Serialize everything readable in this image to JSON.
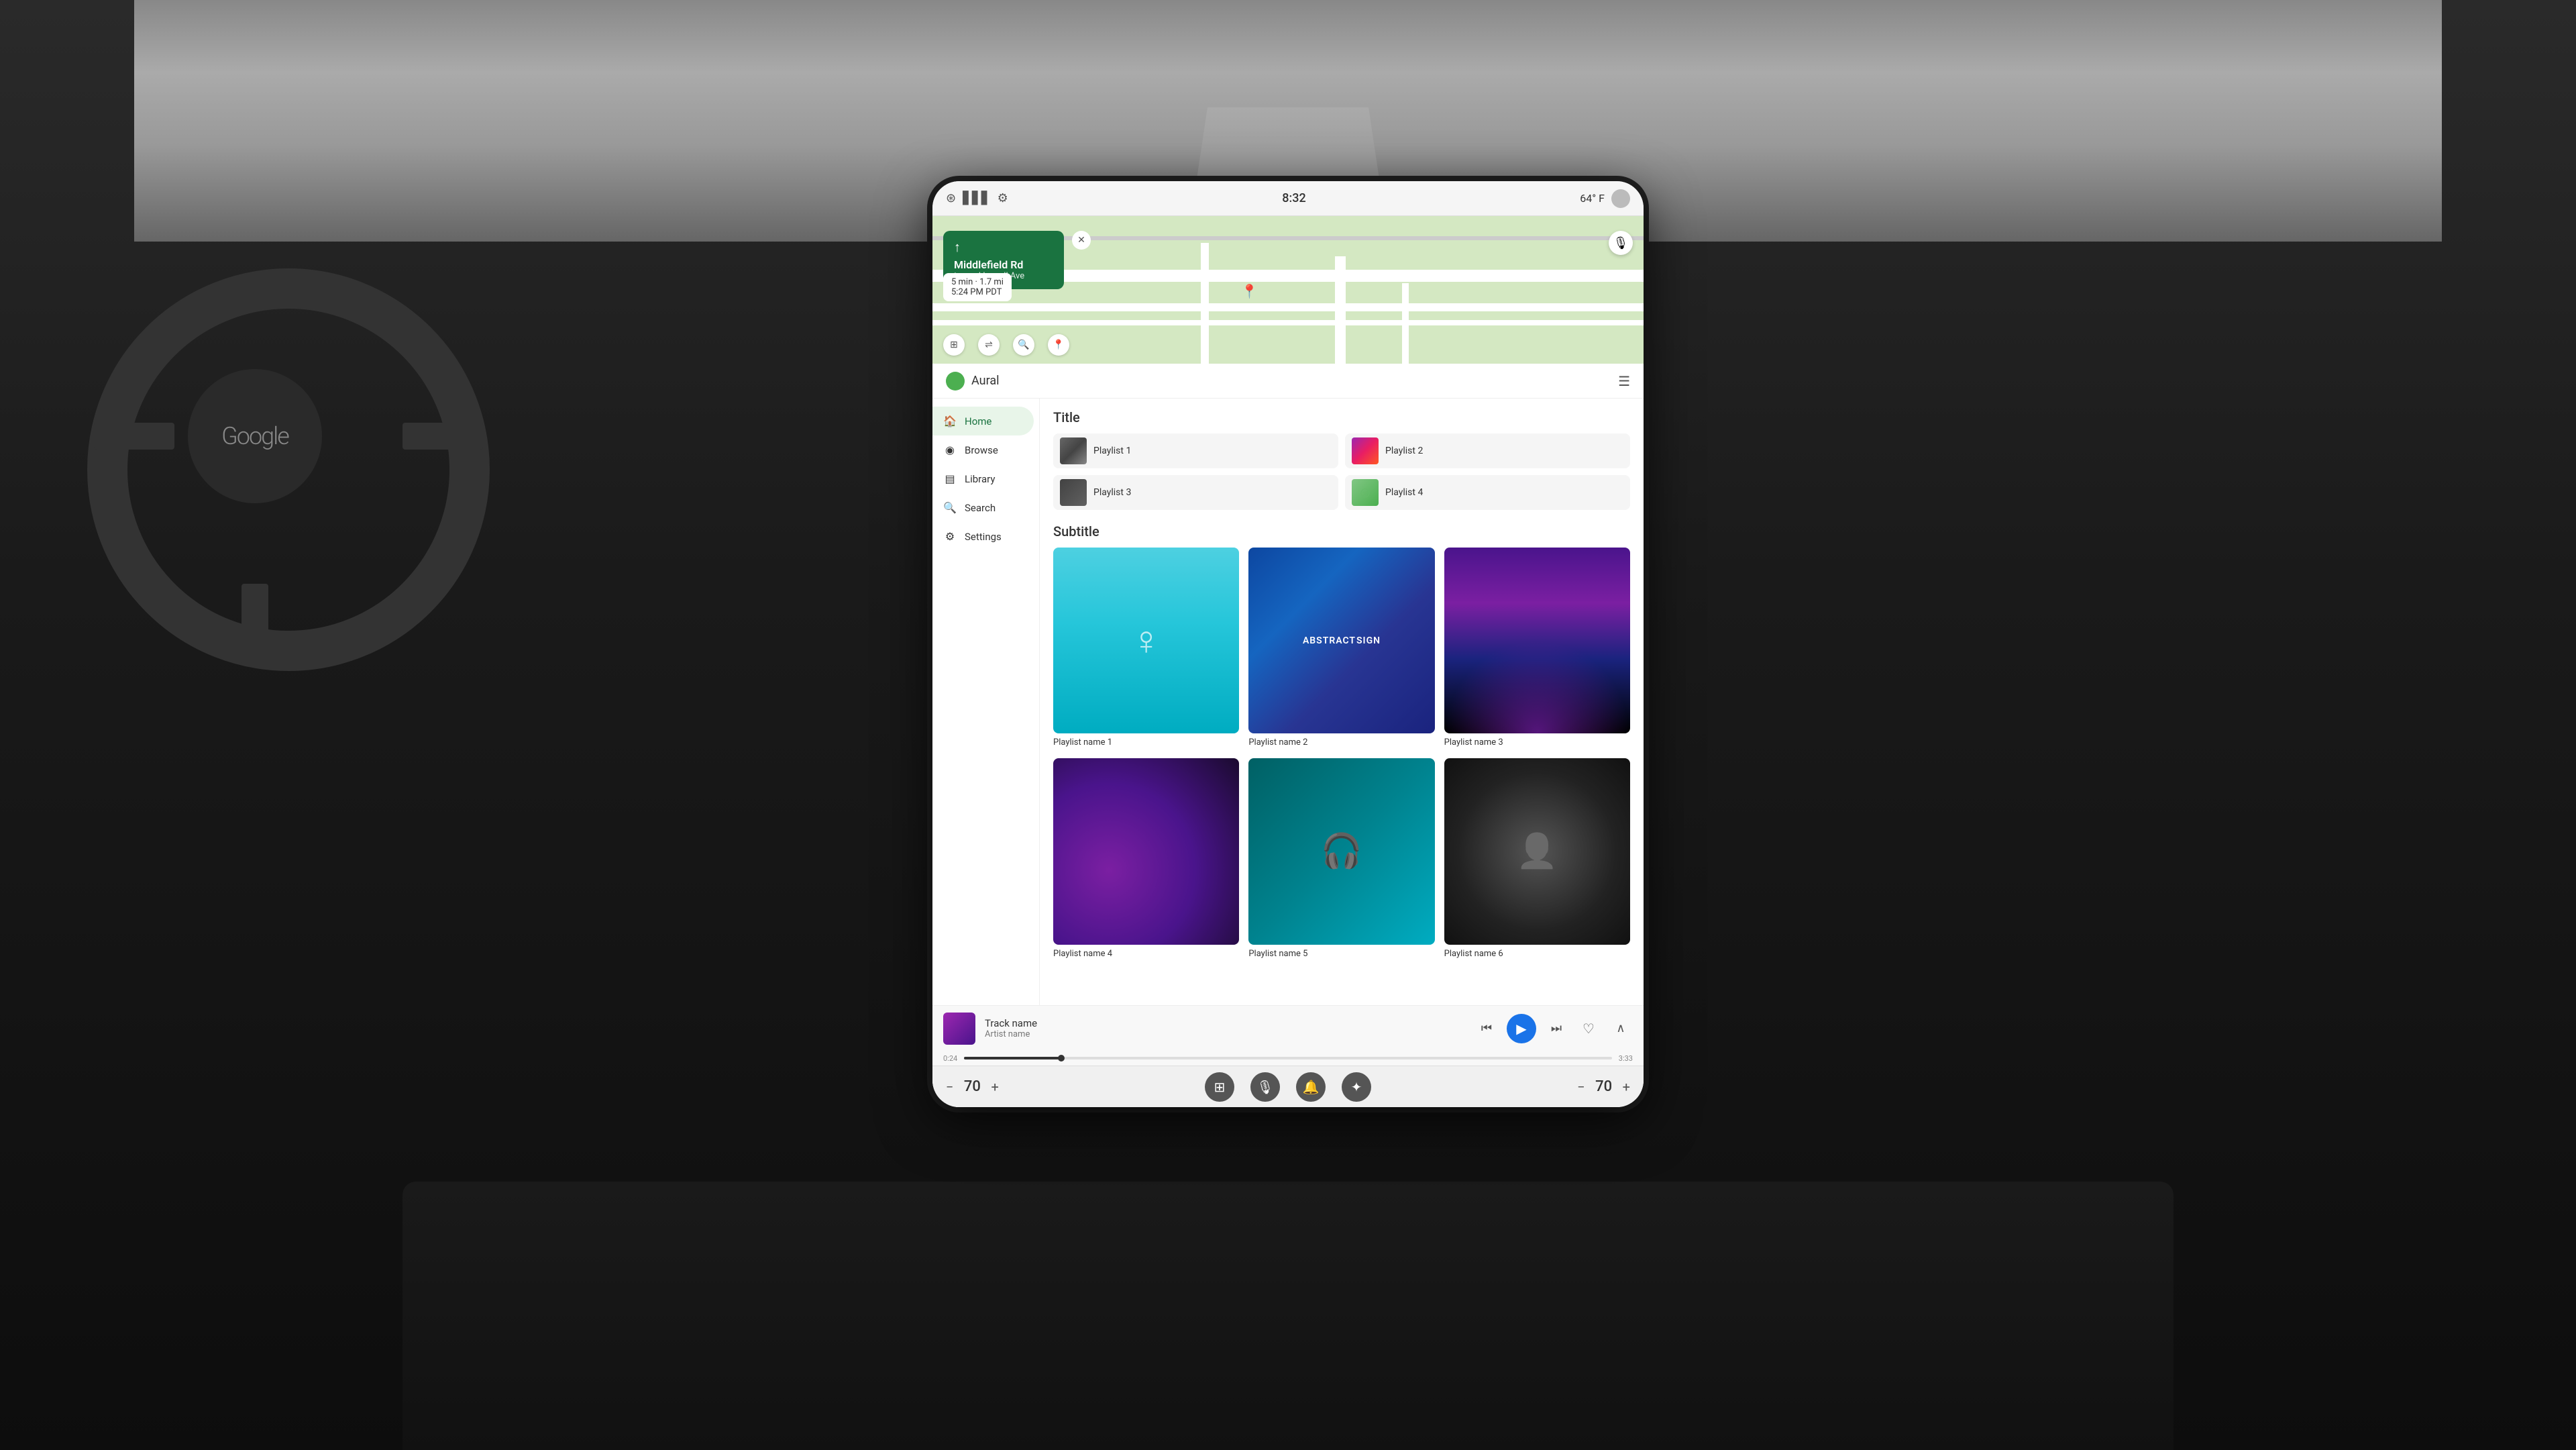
{
  "car": {
    "google_label": "Google"
  },
  "status_bar": {
    "time": "8:32",
    "temperature": "64° F",
    "bluetooth_icon": "🔵",
    "signal_icon": "📶",
    "settings_icon": "⚙"
  },
  "maps": {
    "instruction_street": "Middlefield Rd",
    "instruction_toward": "toward Lowell Ave",
    "eta": "5 min · 1.7 mi",
    "eta_time": "5:24 PM PDT",
    "close_icon": "✕",
    "mic_icon": "🎙",
    "arrow_icon": "↑"
  },
  "app": {
    "name": "Aural",
    "queue_icon": "☰"
  },
  "sidebar": {
    "items": [
      {
        "id": "home",
        "label": "Home",
        "icon": "🏠",
        "active": true
      },
      {
        "id": "browse",
        "label": "Browse",
        "icon": "◉"
      },
      {
        "id": "library",
        "label": "Library",
        "icon": "☰"
      },
      {
        "id": "search",
        "label": "Search",
        "icon": "🔍"
      },
      {
        "id": "settings",
        "label": "Settings",
        "icon": "⚙"
      }
    ]
  },
  "main": {
    "title": "Title",
    "subtitle": "Subtitle",
    "playlists_small": [
      {
        "id": "pl1",
        "label": "Playlist 1",
        "thumb_class": "thumb-1"
      },
      {
        "id": "pl2",
        "label": "Playlist 2",
        "thumb_class": "thumb-2"
      },
      {
        "id": "pl3",
        "label": "Playlist 3",
        "thumb_class": "thumb-3"
      },
      {
        "id": "pl4",
        "label": "Playlist 4",
        "thumb_class": "thumb-4"
      }
    ],
    "playlists_large_row1": [
      {
        "id": "pln1",
        "label": "Playlist name 1",
        "thumb_type": "person"
      },
      {
        "id": "pln2",
        "label": "Playlist name 2",
        "thumb_type": "abstract"
      },
      {
        "id": "pln3",
        "label": "Playlist name 3",
        "thumb_type": "concert"
      }
    ],
    "playlists_large_row2": [
      {
        "id": "pln4",
        "label": "Playlist name 4",
        "thumb_type": "purple"
      },
      {
        "id": "pln5",
        "label": "Playlist name 5",
        "thumb_type": "headphones"
      },
      {
        "id": "pln6",
        "label": "Playlist name 6",
        "thumb_type": "face"
      }
    ]
  },
  "now_playing": {
    "track_name": "Track name",
    "artist_name": "Artist name",
    "time_current": "0:24",
    "time_total": "3:33",
    "progress_percent": 15,
    "prev_icon": "⏮",
    "play_icon": "▶",
    "next_icon": "⏭",
    "heart_icon": "♡",
    "expand_icon": "∧"
  },
  "bottom_bar": {
    "vol_left_minus": "−",
    "vol_left_value": "70",
    "vol_left_plus": "+",
    "vol_right_minus": "−",
    "vol_right_value": "70",
    "vol_right_plus": "+",
    "apps_icon": "⊞",
    "mic_icon": "🎙",
    "bell_icon": "🔔",
    "settings_icon": "✦"
  }
}
